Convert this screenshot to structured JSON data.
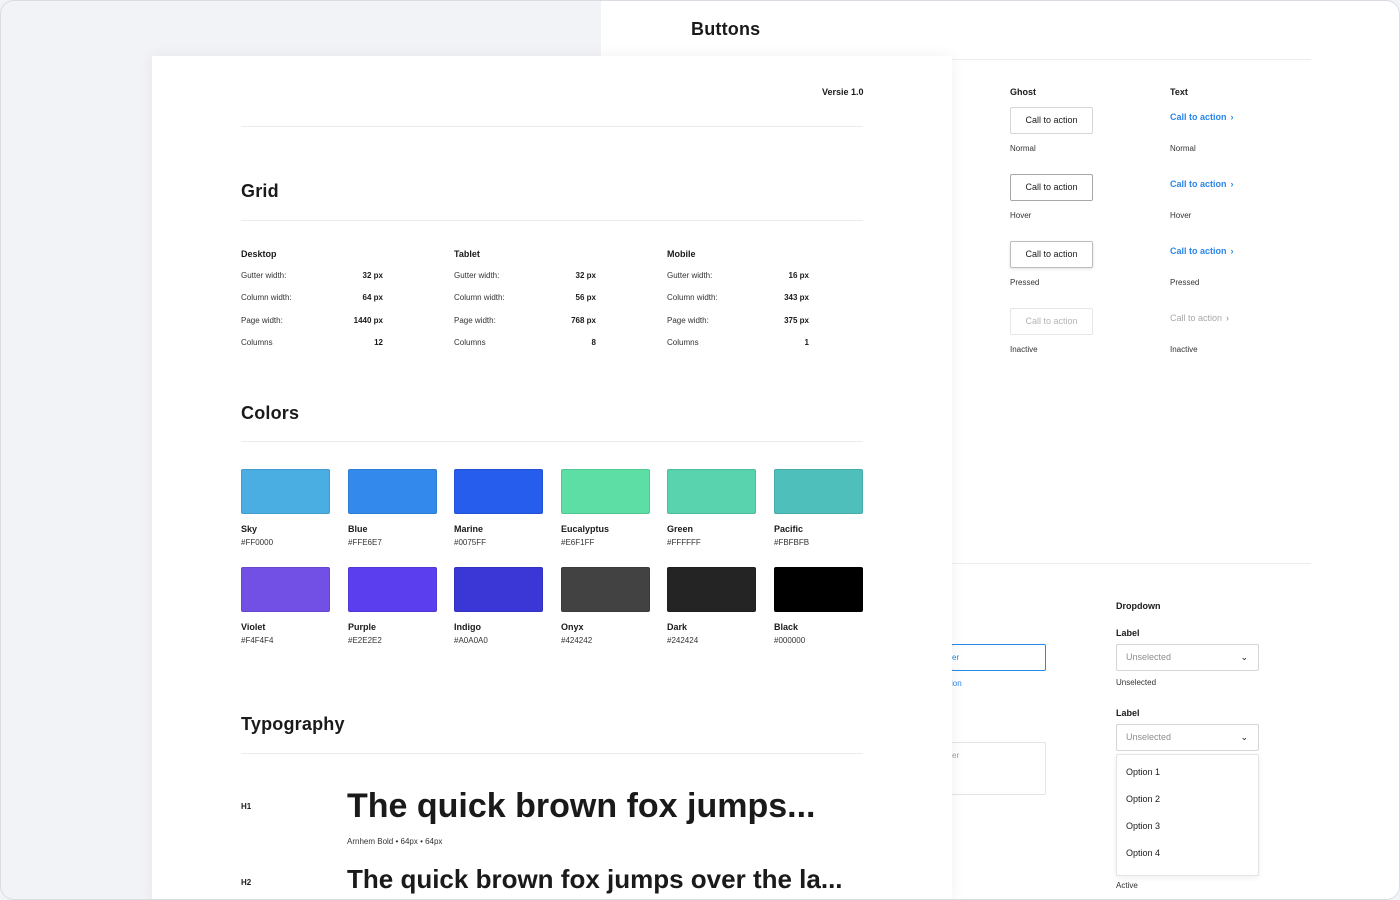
{
  "back": {
    "title": "Buttons",
    "ghost": {
      "heading": "Ghost",
      "button_label": "Call to action",
      "states": [
        "Normal",
        "Hover",
        "Pressed",
        "Inactive"
      ]
    },
    "text": {
      "heading": "Text",
      "button_label": "Call to action",
      "chevron": "›",
      "states": [
        "Normal",
        "Hover",
        "Pressed",
        "Inactive"
      ]
    },
    "partial": {
      "input_fragment": "er",
      "help_fragment": "ion",
      "textarea_fragment": "er"
    },
    "dropdown": {
      "heading": "Dropdown",
      "label_1": "Label",
      "value_1": "Unselected",
      "note_1": "Unselected",
      "label_2": "Label",
      "value_2": "Unselected",
      "chevron": "⌄",
      "options": [
        "Option 1",
        "Option 2",
        "Option 3",
        "Option 4"
      ],
      "note_2": "Active"
    }
  },
  "front": {
    "version": "Versie 1.0",
    "grid": {
      "title": "Grid",
      "columns": [
        {
          "heading": "Desktop",
          "rows": [
            {
              "k": "Gutter width:",
              "v": "32 px"
            },
            {
              "k": "Column width:",
              "v": "64 px"
            },
            {
              "k": "Page width:",
              "v": "1440 px"
            },
            {
              "k": "Columns",
              "v": "12"
            }
          ]
        },
        {
          "heading": "Tablet",
          "rows": [
            {
              "k": "Gutter width:",
              "v": "32 px"
            },
            {
              "k": "Column width:",
              "v": "56 px"
            },
            {
              "k": "Page width:",
              "v": "768 px"
            },
            {
              "k": "Columns",
              "v": "8"
            }
          ]
        },
        {
          "heading": "Mobile",
          "rows": [
            {
              "k": "Gutter width:",
              "v": "16 px"
            },
            {
              "k": "Column width:",
              "v": "343 px"
            },
            {
              "k": "Page width:",
              "v": "375 px"
            },
            {
              "k": "Columns",
              "v": "1"
            }
          ]
        }
      ]
    },
    "colors": {
      "title": "Colors",
      "swatches": [
        {
          "name": "Sky",
          "hex": "#FF0000",
          "fill": "#4aaee2"
        },
        {
          "name": "Blue",
          "hex": "#FFE6E7",
          "fill": "#3489ec"
        },
        {
          "name": "Marine",
          "hex": "#0075FF",
          "fill": "#265ded"
        },
        {
          "name": "Eucalyptus",
          "hex": "#E6F1FF",
          "fill": "#5ddea5"
        },
        {
          "name": "Green",
          "hex": "#FFFFFF",
          "fill": "#58d3ae"
        },
        {
          "name": "Pacific",
          "hex": "#FBFBFB",
          "fill": "#4ebfbb"
        },
        {
          "name": "Violet",
          "hex": "#F4F4F4",
          "fill": "#7250e6"
        },
        {
          "name": "Purple",
          "hex": "#E2E2E2",
          "fill": "#5b3fef"
        },
        {
          "name": "Indigo",
          "hex": "#A0A0A0",
          "fill": "#3a37d6"
        },
        {
          "name": "Onyx",
          "hex": "#424242",
          "fill": "#424242"
        },
        {
          "name": "Dark",
          "hex": "#242424",
          "fill": "#242424"
        },
        {
          "name": "Black",
          "hex": "#000000",
          "fill": "#000000"
        }
      ]
    },
    "typography": {
      "title": "Typography",
      "h1_tag": "H1",
      "h1_sample": "The quick brown fox jumps...",
      "h1_meta": "Arnhem Bold • 64px • 64px",
      "h2_tag": "H2",
      "h2_sample": "The quick brown fox jumps over the la..."
    }
  },
  "colors": {
    "accent": "#2b86e6"
  }
}
